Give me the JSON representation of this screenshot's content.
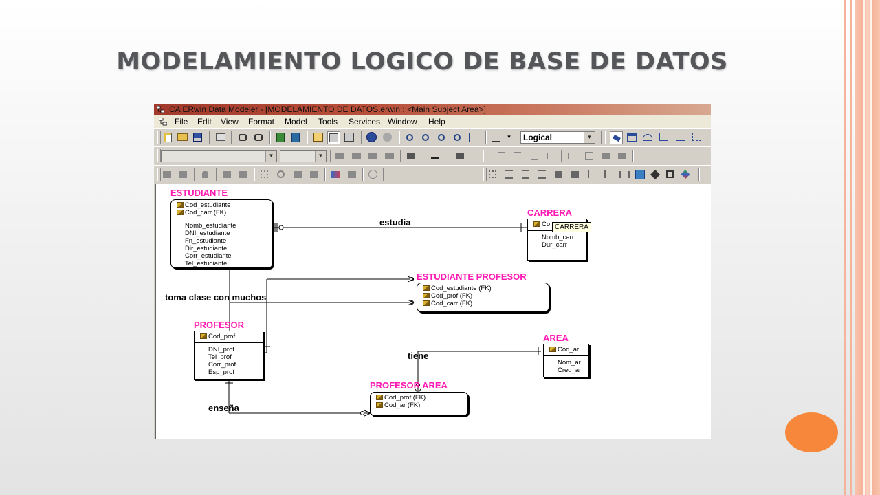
{
  "slide": {
    "title": "MODELAMIENTO LOGICO DE BASE DE DATOS",
    "accent_color": "#f7873a",
    "border_color": "#f5b49a"
  },
  "window": {
    "title": "CA ERwin Data Modeler - [MODELAMIENTO DE DATOS.erwin : <Main Subject Area>]"
  },
  "menu": [
    "File",
    "Edit",
    "View",
    "Format",
    "Model",
    "Tools",
    "Services",
    "Window",
    "Help"
  ],
  "toolbar": {
    "view_select": "Logical"
  },
  "diagram": {
    "estudiante": {
      "name": "ESTUDIANTE",
      "keys": [
        "Cod_estudiante",
        "Cod_carr (FK)"
      ],
      "attrs": [
        "Nomb_estudiante",
        "DNI_estudiante",
        "Fn_estudiante",
        "Dir_estudiante",
        "Corr_estudiante",
        "Tel_estudiante"
      ]
    },
    "carrera": {
      "name": "CARRERA",
      "keys": [
        "Co"
      ],
      "attrs": [
        "Nomb_carr",
        "Dur_carr"
      ],
      "tooltip": "CARRERA"
    },
    "estudiante_profesor": {
      "name": "ESTUDIANTE PROFESOR",
      "keys": [
        "Cod_estudiante (FK)",
        "Cod_prof (FK)",
        "Cod_carr (FK)"
      ]
    },
    "profesor": {
      "name": "PROFESOR",
      "keys": [
        "Cod_prof"
      ],
      "attrs": [
        "DNI_prof",
        "Tel_prof",
        "Corr_prof",
        "Esp_prof"
      ]
    },
    "area": {
      "name": "AREA",
      "keys": [
        "Cod_ar"
      ],
      "attrs": [
        "Nom_ar",
        "Cred_ar"
      ]
    },
    "profesor_area": {
      "name": "PROFESOR AREA",
      "keys": [
        "Cod_prof (FK)",
        "Cod_ar (FK)"
      ]
    },
    "relationships": {
      "estudia": "estudia",
      "toma": "toma clase con muchos",
      "tiene": "tiene",
      "ensena": "enseña"
    }
  }
}
